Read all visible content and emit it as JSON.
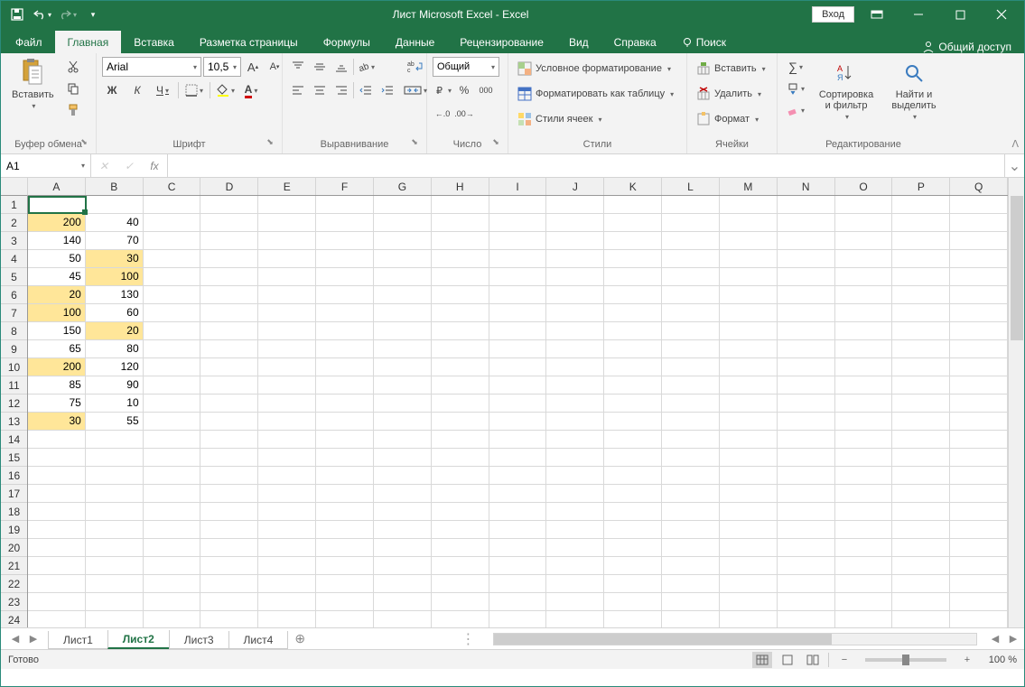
{
  "title": "Лист Microsoft Excel  -  Excel",
  "login": "Вход",
  "tabs": [
    "Файл",
    "Главная",
    "Вставка",
    "Разметка страницы",
    "Формулы",
    "Данные",
    "Рецензирование",
    "Вид",
    "Справка",
    "Поиск"
  ],
  "active_tab": 1,
  "share": "Общий доступ",
  "ribbon": {
    "clipboard": {
      "paste": "Вставить",
      "label": "Буфер обмена"
    },
    "font": {
      "name": "Arial",
      "size": "10,5",
      "bold": "Ж",
      "italic": "К",
      "underline": "Ч",
      "label": "Шрифт"
    },
    "alignment": {
      "label": "Выравнивание"
    },
    "number": {
      "format": "Общий",
      "label": "Число"
    },
    "styles": {
      "cond": "Условное форматирование",
      "table": "Форматировать как таблицу",
      "cell": "Стили ячеек",
      "label": "Стили"
    },
    "cells": {
      "insert": "Вставить",
      "delete": "Удалить",
      "format": "Формат",
      "label": "Ячейки"
    },
    "editing": {
      "sort": "Сортировка и фильтр",
      "find": "Найти и выделить",
      "label": "Редактирование"
    }
  },
  "name_box": "A1",
  "columns": [
    "A",
    "B",
    "C",
    "D",
    "E",
    "F",
    "G",
    "H",
    "I",
    "J",
    "K",
    "L",
    "M",
    "N",
    "O",
    "P",
    "Q"
  ],
  "rows": [
    1,
    2,
    3,
    4,
    5,
    6,
    7,
    8,
    9,
    10,
    11,
    12,
    13,
    14,
    15,
    16,
    17,
    18,
    19,
    20,
    21,
    22,
    23,
    24
  ],
  "data": {
    "A": [
      "",
      "200",
      "140",
      "50",
      "45",
      "20",
      "100",
      "150",
      "65",
      "200",
      "85",
      "75",
      "30"
    ],
    "B": [
      "",
      "40",
      "70",
      "30",
      "100",
      "130",
      "60",
      "20",
      "80",
      "120",
      "90",
      "10",
      "55"
    ]
  },
  "highlights": {
    "A": [
      2,
      6,
      7,
      10,
      13
    ],
    "B": [
      4,
      5,
      8
    ]
  },
  "sheets": [
    "Лист1",
    "Лист2",
    "Лист3",
    "Лист4"
  ],
  "active_sheet": 1,
  "status": "Готово",
  "zoom": "100 %"
}
